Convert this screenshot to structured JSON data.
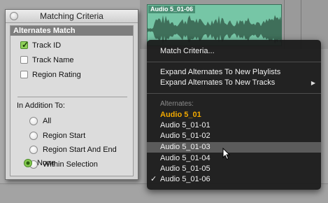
{
  "window": {
    "title": "Matching Criteria",
    "section_title": "Alternates Match",
    "checkboxes": [
      {
        "label": "Track ID",
        "checked": true
      },
      {
        "label": "Track Name",
        "checked": false
      },
      {
        "label": "Region Rating",
        "checked": false
      }
    ],
    "additional_label": "In Addition To:",
    "radios": [
      {
        "label": "All",
        "selected": false
      },
      {
        "label": "Region Start",
        "selected": false
      },
      {
        "label": "Region Start And End",
        "selected": false
      },
      {
        "label": "Within Selection",
        "selected": false
      },
      {
        "label": "None",
        "selected": true
      }
    ]
  },
  "region": {
    "name": "Audio 5_01-06",
    "color": "#76c6a6"
  },
  "menu": {
    "match_criteria": "Match Criteria...",
    "expand_playlists": "Expand Alternates To New Playlists",
    "expand_tracks": "Expand Alternates To New Tracks",
    "alternates_header": "Alternates:",
    "alternates": [
      {
        "label": "Audio 5_01",
        "current": true,
        "checked": false
      },
      {
        "label": "Audio 5_01-01",
        "current": false,
        "checked": false
      },
      {
        "label": "Audio 5_01-02",
        "current": false,
        "checked": false
      },
      {
        "label": "Audio 5_01-03",
        "current": false,
        "checked": false,
        "highlighted": true
      },
      {
        "label": "Audio 5_01-04",
        "current": false,
        "checked": false
      },
      {
        "label": "Audio 5_01-05",
        "current": false,
        "checked": false
      },
      {
        "label": "Audio 5_01-06",
        "current": false,
        "checked": true
      }
    ],
    "check_glyph": "✓",
    "accent_color": "#f2a900"
  }
}
